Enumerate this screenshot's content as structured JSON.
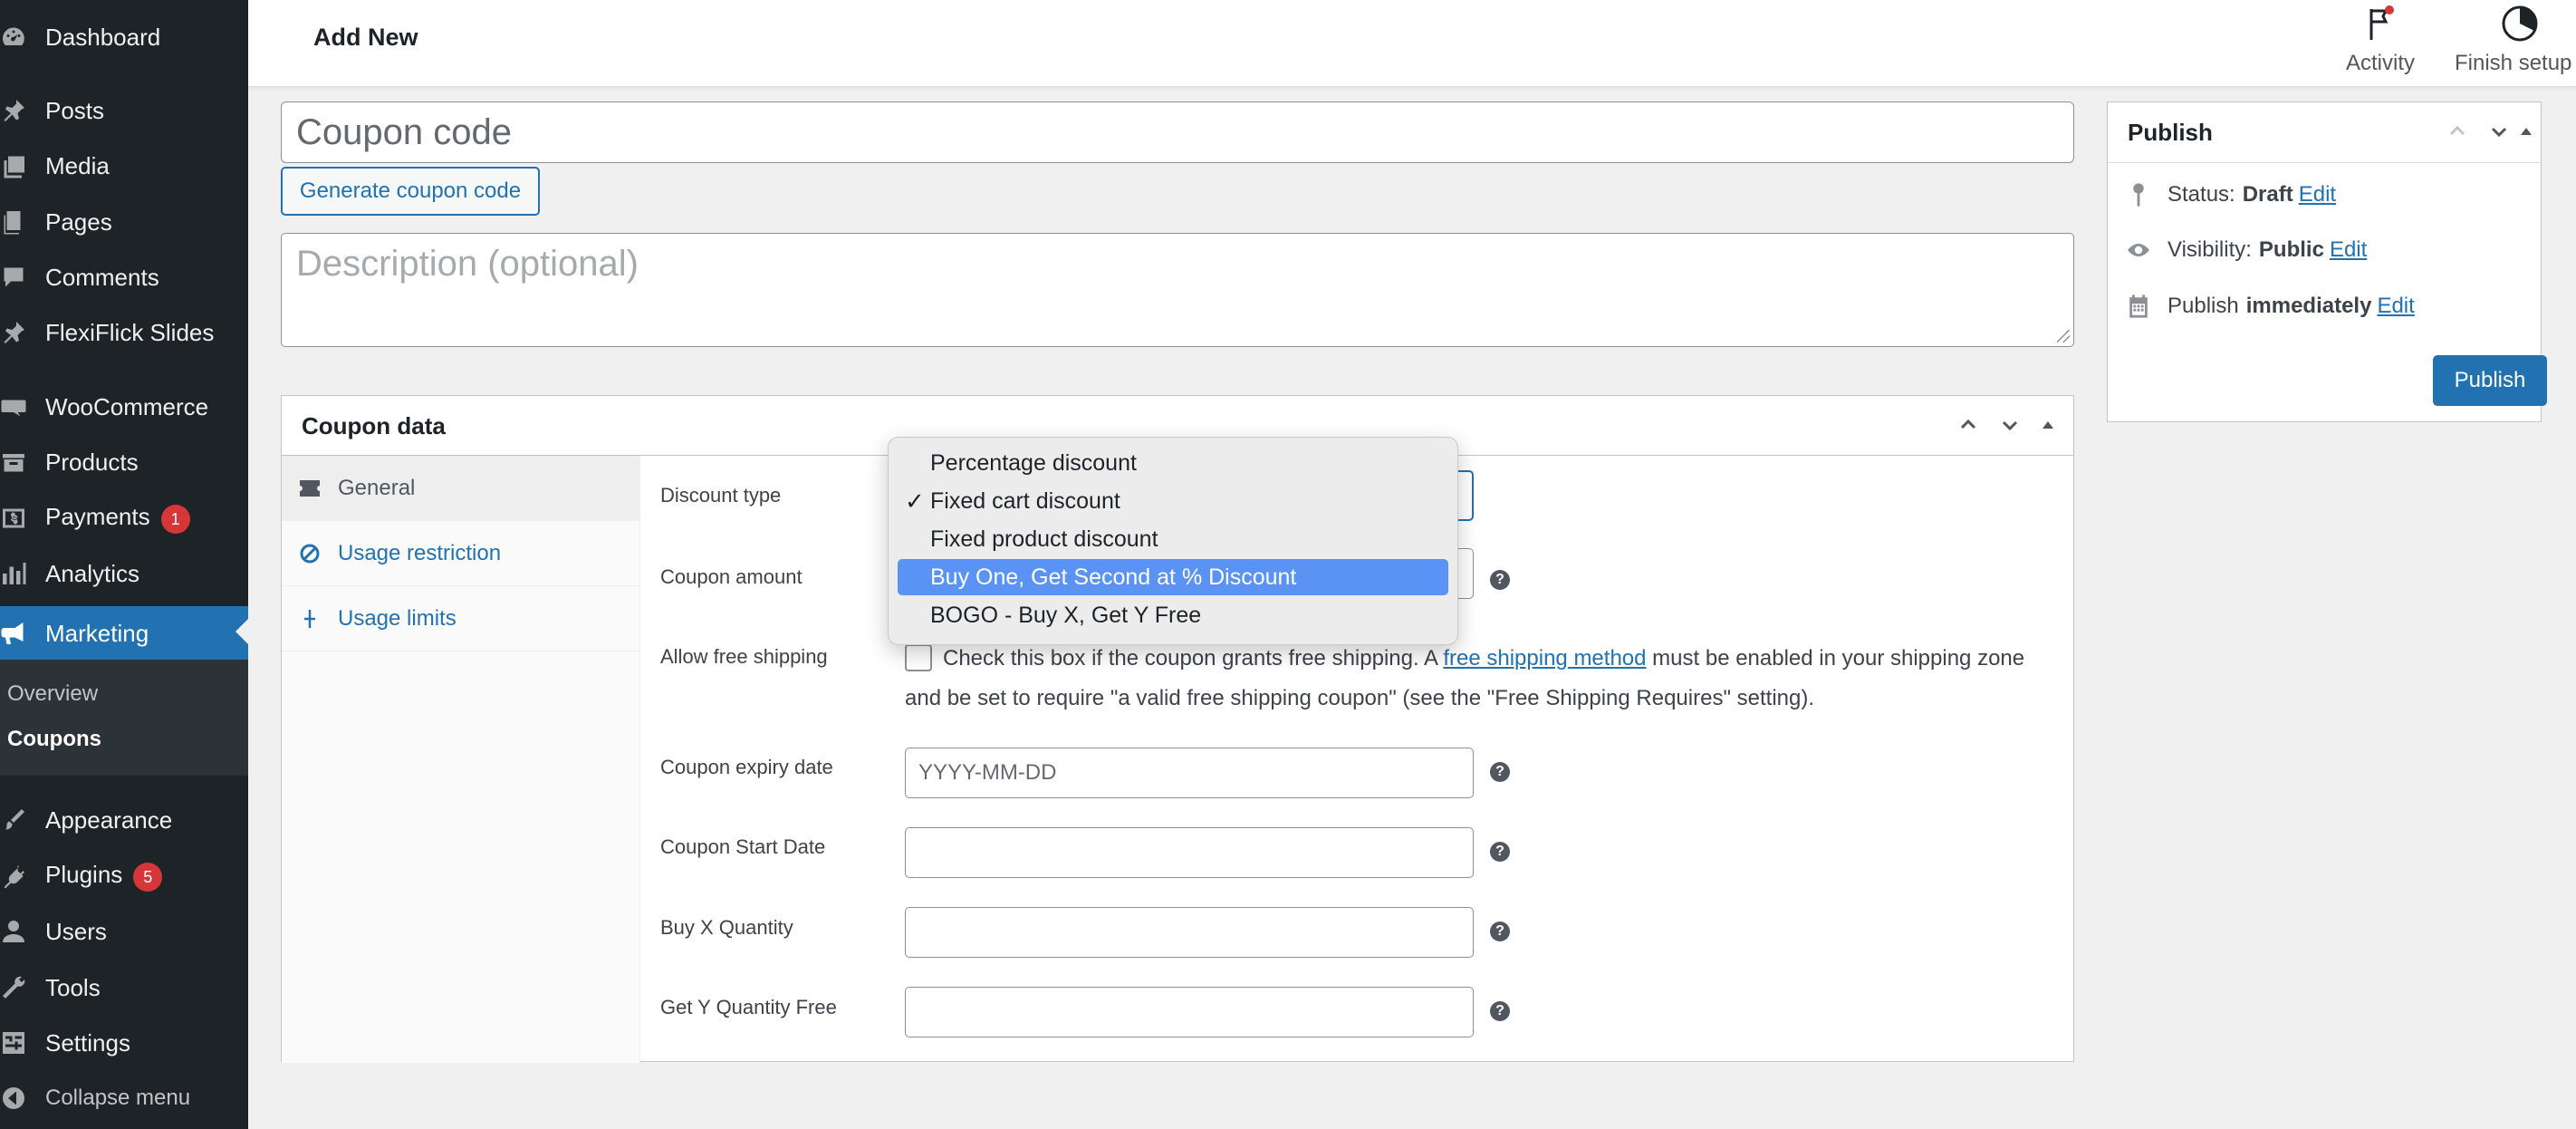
{
  "sidebar": {
    "items": [
      {
        "label": "Dashboard",
        "icon": "dashboard-icon"
      },
      {
        "label": "Posts",
        "icon": "pin-icon"
      },
      {
        "label": "Media",
        "icon": "media-icon"
      },
      {
        "label": "Pages",
        "icon": "pages-icon"
      },
      {
        "label": "Comments",
        "icon": "comment-icon"
      },
      {
        "label": "FlexiFlick Slides",
        "icon": "pin-icon"
      },
      {
        "label": "WooCommerce",
        "icon": "woo-icon"
      },
      {
        "label": "Products",
        "icon": "archive-icon"
      },
      {
        "label": "Payments",
        "icon": "dollar-icon",
        "badge": "1"
      },
      {
        "label": "Analytics",
        "icon": "bar-chart-icon"
      },
      {
        "label": "Marketing",
        "icon": "megaphone-icon"
      },
      {
        "label": "Appearance",
        "icon": "brush-icon"
      },
      {
        "label": "Plugins",
        "icon": "plug-icon",
        "badge": "5"
      },
      {
        "label": "Users",
        "icon": "user-icon"
      },
      {
        "label": "Tools",
        "icon": "wrench-icon"
      },
      {
        "label": "Settings",
        "icon": "settings-icon"
      },
      {
        "label": "Collapse menu",
        "icon": "collapse-icon"
      }
    ],
    "submenu": [
      "Overview",
      "Coupons"
    ]
  },
  "header": {
    "title": "Add New",
    "activity_label": "Activity",
    "finish_setup_label": "Finish setup"
  },
  "coupon": {
    "code_placeholder": "Coupon code",
    "generate_label": "Generate coupon code",
    "description_placeholder": "Description (optional)"
  },
  "coupon_data": {
    "title": "Coupon data",
    "tabs": [
      "General",
      "Usage restriction",
      "Usage limits"
    ],
    "fields": {
      "discount_type": "Discount type",
      "coupon_amount": "Coupon amount",
      "free_shipping": "Allow free shipping",
      "expiry_date": "Coupon expiry date",
      "expiry_placeholder": "YYYY-MM-DD",
      "start_date": "Coupon Start Date",
      "buy_x": "Buy X Quantity",
      "get_y": "Get Y Quantity Free"
    },
    "shipping_text_before": "Check this box if the coupon grants free shipping. A ",
    "shipping_link": "free shipping method",
    "shipping_text_after": " must be enabled in your shipping zone and be set to require \"a valid free shipping coupon\" (see the \"Free Shipping Requires\" setting).",
    "help_glyph": "?"
  },
  "dropdown": {
    "options": [
      "Percentage discount",
      "Fixed cart discount",
      "Fixed product discount",
      "Buy One, Get Second at % Discount",
      "BOGO - Buy X, Get Y Free"
    ],
    "checked": "Fixed cart discount",
    "highlighted": "Buy One, Get Second at % Discount",
    "check_glyph": "✓"
  },
  "publish": {
    "title": "Publish",
    "status_label": "Status:",
    "status_value": "Draft",
    "visibility_label": "Visibility:",
    "visibility_value": "Public",
    "publish_label": "Publish",
    "publish_value": "immediately",
    "edit_label": "Edit",
    "button_label": "Publish"
  },
  "colors": {
    "sidebar_bg": "#1d2327",
    "accent": "#2271b1",
    "badge": "#d63638",
    "highlight": "#5a93f4"
  }
}
